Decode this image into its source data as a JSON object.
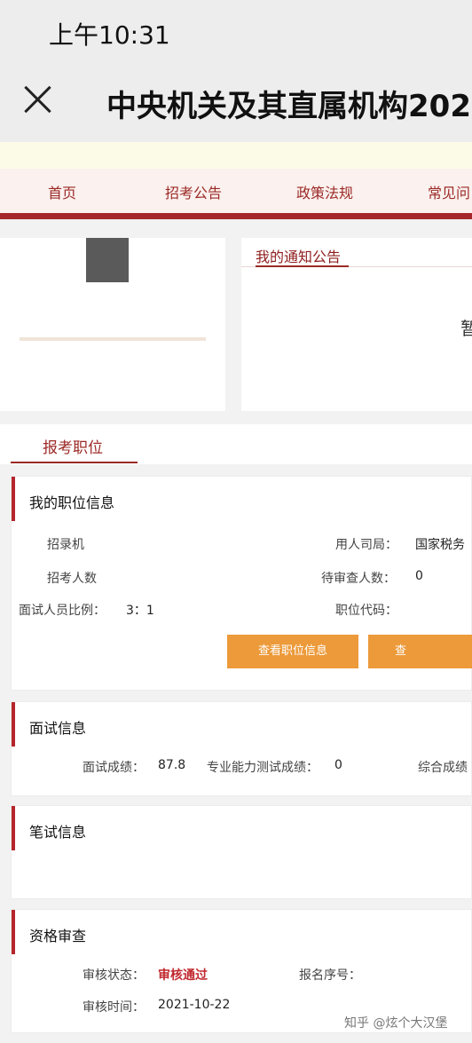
{
  "status": {
    "time": "上午10:31"
  },
  "titlebar": {
    "title": "中央机关及其直属机构202"
  },
  "nav": {
    "items": [
      "首页",
      "招考公告",
      "政策法规",
      "常见问"
    ]
  },
  "notices": {
    "title": "我的通知公告",
    "empty": "暂"
  },
  "tabs": {
    "active": "报考职位"
  },
  "position_card": {
    "title": "我的职位信息",
    "recruit_org_label": "招录机",
    "hiring_bureau_label": "用人司局：",
    "hiring_bureau_value": "国家税务",
    "applicants_label": "招考人数",
    "pending_label": "待审查人数：",
    "pending_value": "0",
    "ratio_label": "面试人员比例：",
    "ratio_value": "3：1",
    "code_label": "职位代码：",
    "view_button": "查看职位信息",
    "second_button": "查"
  },
  "interview_card": {
    "title": "面试信息",
    "score_label": "面试成绩：",
    "score_value": "87.8",
    "ability_label": "专业能力测试成绩：",
    "ability_value": "0",
    "total_label": "综合成绩"
  },
  "written_card": {
    "title": "笔试信息"
  },
  "qualify_card": {
    "title": "资格审查",
    "status_label": "审核状态：",
    "status_value": "审核通过",
    "serial_label": "报名序号：",
    "time_label": "审核时间：",
    "time_value": "2021-10-22"
  },
  "watermark": "知乎 @炫个大汉堡",
  "colors": {
    "accent": "#a5262c",
    "button": "#ec9a3a",
    "status_pass": "#c0282e"
  }
}
